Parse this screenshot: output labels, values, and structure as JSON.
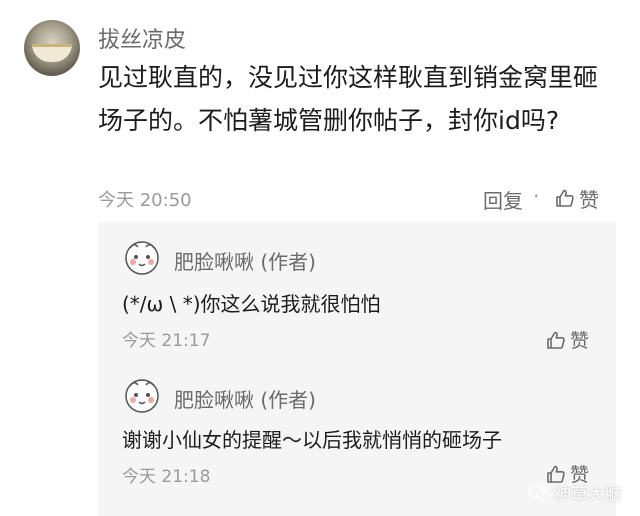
{
  "comment": {
    "username": "拔丝凉皮",
    "text": "见过耿直的，没见过你这样耿直到销金窝里砸场子的。不怕薯城管删你帖子，封你id吗?",
    "time": "今天 20:50",
    "reply_label": "回复",
    "separator": "·",
    "like_label": "赞"
  },
  "replies": [
    {
      "username": "肥脸啾啾 (作者)",
      "text": "(*/ω \\ *)你这么说我就很怕怕",
      "time": "今天 21:17",
      "like_label": "赞"
    },
    {
      "username": "肥脸啾啾 (作者)",
      "text": "谢谢小仙女的提醒～以后我就悄悄的砸场子",
      "time": "今天 21:18",
      "like_label": "赞"
    }
  ],
  "watermark": {
    "text": "神草大脑",
    "icon": "wechat-icon"
  },
  "colors": {
    "muted_text": "#9a9a9a",
    "secondary_text": "#6b6b6b",
    "reply_background": "#f5f5f5"
  }
}
